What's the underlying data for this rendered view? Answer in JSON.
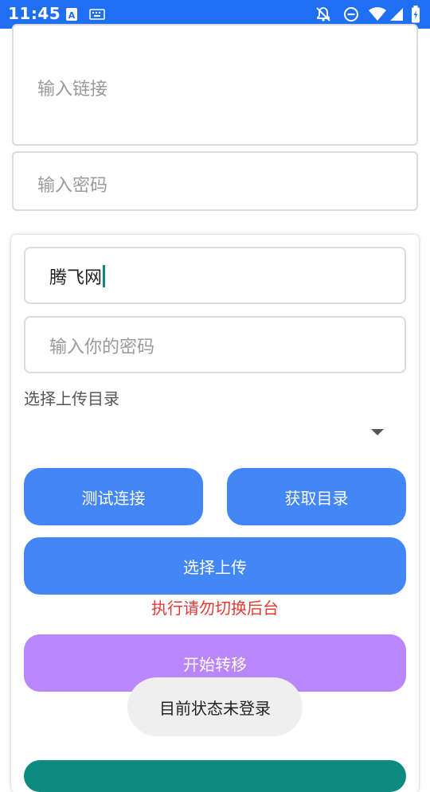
{
  "status_bar": {
    "time": "11:45",
    "icons": [
      "a-badge-icon",
      "keyboard-icon",
      "bell-off-icon",
      "dnd-icon",
      "wifi-icon",
      "signal-icon",
      "battery-icon"
    ]
  },
  "top_fields": {
    "link_placeholder": "输入链接",
    "password_placeholder": "输入密码"
  },
  "card": {
    "name_value": "腾飞网",
    "password_placeholder": "输入你的密码",
    "select_dir_label": "选择上传目录",
    "test_connection_label": "测试连接",
    "get_directory_label": "获取目录",
    "select_upload_label": "选择上传",
    "warning_text": "执行请勿切换后台",
    "start_transfer_label": "开始转移"
  },
  "toast": {
    "text": "目前状态未登录"
  },
  "colors": {
    "status_bar": "#1e6ff2",
    "primary_button": "#4387f6",
    "transfer_button": "#bb86fb",
    "warning": "#e53935",
    "caret": "#0d8a7d",
    "bottom_button": "#0f8a80"
  }
}
